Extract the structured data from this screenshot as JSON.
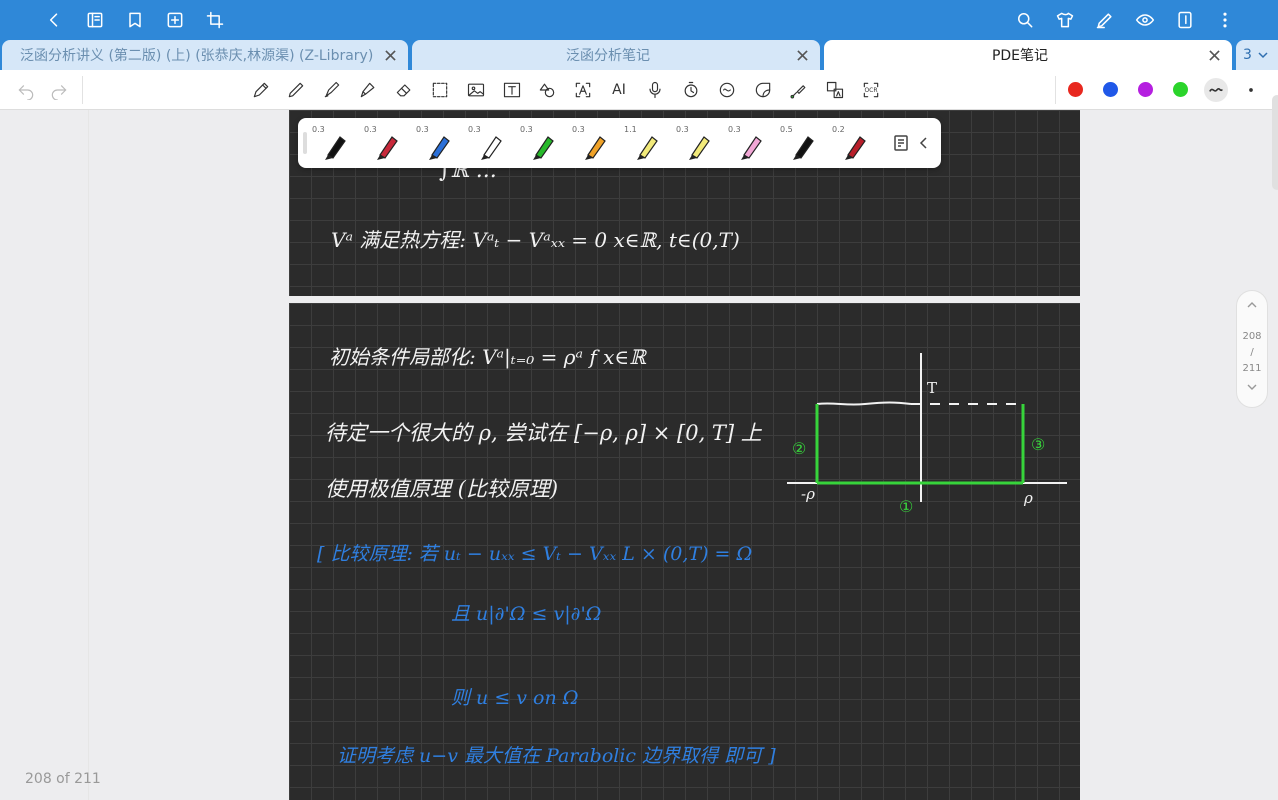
{
  "tabs": [
    {
      "label": "泛函分析讲义 (第二版) (上) (张恭庆,林源渠) (Z-Library)",
      "active": false
    },
    {
      "label": "泛函分析笔记",
      "active": false
    },
    {
      "label": "PDE笔记",
      "active": true
    }
  ],
  "tab_count": "3",
  "toolbar": {
    "ai_label": "AI",
    "ocr_label": "OCR"
  },
  "colors": [
    "#e8281f",
    "#2058e8",
    "#b51fe0",
    "#2bd42b"
  ],
  "pens": [
    {
      "size": "0.3",
      "color": "#111111"
    },
    {
      "size": "0.3",
      "color": "#c8283a"
    },
    {
      "size": "0.3",
      "color": "#2a6fd8"
    },
    {
      "size": "0.3",
      "color": "#ffffff"
    },
    {
      "size": "0.3",
      "color": "#27b92a"
    },
    {
      "size": "0.3",
      "color": "#f0a228"
    },
    {
      "size": "1.1",
      "color": "#f2ea7a"
    },
    {
      "size": "0.3",
      "color": "#f2ea7a"
    },
    {
      "size": "0.3",
      "color": "#f2a7d6"
    },
    {
      "size": "0.5",
      "color": "#111111"
    },
    {
      "size": "0.2",
      "color": "#b81f2a"
    }
  ],
  "page_nav": {
    "current": "208",
    "sep": "/",
    "total": "211"
  },
  "footer": "208 of 211",
  "notes": {
    "p1_integral": "∫ℝ ...",
    "p1_line": "Vᵃ 满足热方程:   Vᵃₜ − Vᵃₓₓ = 0        x∈ℝ,   t∈(0,T)",
    "p2_line1": "初始条件局部化:   Vᵃ|ₜ₌₀ = ρᵃ f        x∈ℝ",
    "p2_line2": "待定一个很大的 ρ, 尝试在 [−ρ, ρ] × [0, T] 上",
    "p2_line3": "使用极值原理 (比较原理)",
    "p2_line4": "[ 比较原理:  若 uₜ − uₓₓ ≤ Vₜ − Vₓₓ     L × (0,T) = Ω",
    "p2_line5": "且  u|∂'Ω  ≤  v|∂'Ω",
    "p2_line6": "则  u ≤ v     on Ω",
    "p2_line7": "证明考虑 u−v 最大值在 Parabolic 边界取得 即可   ]",
    "fig_T": "T",
    "fig_neg_rho": "-ρ",
    "fig_rho": "ρ",
    "fig_1": "①",
    "fig_2": "②",
    "fig_3": "③"
  }
}
